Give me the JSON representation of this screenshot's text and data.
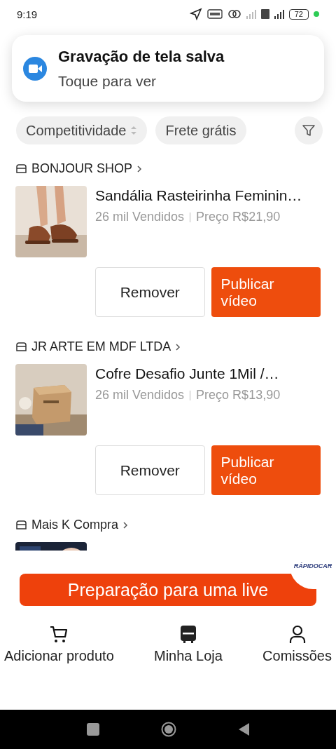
{
  "status_bar": {
    "time": "9:19",
    "battery": "72"
  },
  "notification": {
    "title": "Gravação de tela salva",
    "subtitle": "Toque para ver"
  },
  "filters": [
    {
      "kind": "sort",
      "label": "Competitividade"
    },
    {
      "kind": "plain",
      "label": "Frete grátis"
    },
    {
      "kind": "filter"
    }
  ],
  "shops": [
    {
      "name": "BONJOUR SHOP",
      "product": {
        "kind": "full",
        "title": "Sandália Rasteirinha Feminin…",
        "sold": "26 mil Vendidos",
        "price": "Preço R$21,90",
        "actions": [
          "Remover",
          "Publicar vídeo"
        ]
      }
    },
    {
      "name": "JR ARTE EM MDF LTDA",
      "product": {
        "kind": "full",
        "title": "Cofre Desafio Junte 1Mil /…",
        "sold": "26 mil Vendidos",
        "price": "Preço R$13,90",
        "actions": [
          "Remover",
          "Publicar vídeo"
        ]
      }
    },
    {
      "name": "Mais K Compra",
      "product": {
        "kind": "partial"
      }
    }
  ],
  "floating_badge": {
    "label": "RÁPIDOCAR"
  },
  "live_button": "Preparação para uma live",
  "nav": [
    {
      "label": "Adicionar produto"
    },
    {
      "label": "Minha Loja"
    },
    {
      "label": "Comissões"
    }
  ]
}
